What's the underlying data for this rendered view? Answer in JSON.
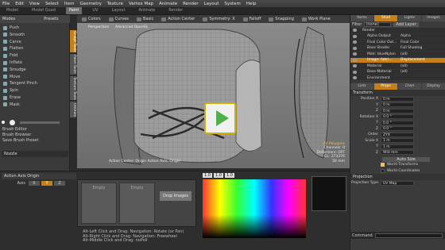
{
  "menu": [
    "File",
    "Edit",
    "View",
    "Select",
    "Item",
    "Geometry",
    "Texture",
    "Vertex Map",
    "Animate",
    "Render",
    "Layout",
    "System",
    "Help"
  ],
  "layout_tabs": [
    "Model",
    "Model Quad",
    "Paint",
    "UV",
    "Layout",
    "Animate",
    "Render"
  ],
  "active_layout_tab": "Paint",
  "left_header": {
    "mode_label": "Modes",
    "presets_label": "Presets"
  },
  "tools": [
    "Push",
    "Smooth",
    "Carve",
    "Flatten",
    "Fold",
    "Inflate",
    "Smudge",
    "Move",
    "Tangent Pinch",
    "Spin",
    "Erase",
    "Mask"
  ],
  "brush_items": [
    "Brush Editor",
    "Brush Browser",
    "Save Brush Preset"
  ],
  "nozzle_label": "Nozzle",
  "vertical_tabs": [
    "Sculpt Tools",
    "Paint Tools",
    "Texture Tools",
    "Utilities"
  ],
  "viewport_header": {
    "items": [
      "Colors",
      "Curves",
      "Basic",
      "Action Center",
      "Symmetry: X",
      "Falloff",
      "Snapping",
      "Work Plane"
    ]
  },
  "viewport": {
    "labels": [
      "Perspective",
      "Advanced OpenGL"
    ],
    "stats": [
      "All Polygons",
      "Channels: 0",
      "Deformers: OFF",
      "GL: 273376",
      "50 mm"
    ],
    "action_center": "Action Center: Origin  Action Axis: Origin"
  },
  "bottom": {
    "action_axis": "Action Axis Origin",
    "axis_label": "Axis",
    "axis_values": [
      "X",
      "Y",
      "Z"
    ],
    "color_values": [
      "1.0",
      "1.0",
      "1.0"
    ],
    "tips": [
      "Alt-Left Click and Drag: Navigation: Rotate (or Pan)",
      "Alt-Right Click and Drag: Navigation: Freewheel",
      "Alt-Middle Click and Drag: noPoll"
    ],
    "image_slots": [
      "Empty",
      "Empty",
      "Drop Images"
    ]
  },
  "right": {
    "filter_label": "Filter",
    "filter_value": "(none)",
    "add_layer": "Add Layer",
    "top_tabs": [
      "Items",
      "Shad",
      "Lights",
      "Images"
    ],
    "shader_tree": [
      {
        "name": "Render",
        "effect": ""
      },
      {
        "name": "Alpha Output",
        "effect": "Alpha"
      },
      {
        "name": "Final Color Out...",
        "effect": "Final Color"
      },
      {
        "name": "Base Shader",
        "effect": "Full Shading"
      },
      {
        "name": "Matr: blueNylon",
        "effect": "(all)"
      },
      {
        "name": "Image: fabri...",
        "effect": "Displacement"
      },
      {
        "name": "Material",
        "effect": "(all)"
      },
      {
        "name": "Base Material",
        "effect": "(all)"
      },
      {
        "name": "Environment",
        "effect": ""
      }
    ],
    "selected_index": 5,
    "mid_tabs": [
      "Lists",
      "Props",
      "Chan",
      "Display"
    ],
    "transform_title": "Transform",
    "position": [
      {
        "axis": "X",
        "value": "0 m"
      },
      {
        "axis": "Y",
        "value": "0 m"
      },
      {
        "axis": "Z",
        "value": "0 m"
      }
    ],
    "rotation": [
      {
        "axis": "X",
        "value": "0.0 °"
      },
      {
        "axis": "Y",
        "value": "0.0 °"
      },
      {
        "axis": "Z",
        "value": "0.0 °"
      }
    ],
    "order_label": "Order",
    "order_value": "ZYX",
    "scale": [
      {
        "axis": "X",
        "value": "1 m"
      },
      {
        "axis": "Y",
        "value": "1 m"
      },
      {
        "axis": "Z",
        "value": "Wld mm"
      }
    ],
    "auto_size": "Auto Size",
    "world_transforms": "World Transforms",
    "world_coordinates": "World Coordinates",
    "projection_title": "Projection",
    "projection_type_label": "Projection Type",
    "projection_type_value": "UV Map",
    "command_label": "Command"
  },
  "colors": {
    "accent": "#c5801a",
    "play_border": "#d0b000",
    "play_icon": "#52b04c"
  }
}
